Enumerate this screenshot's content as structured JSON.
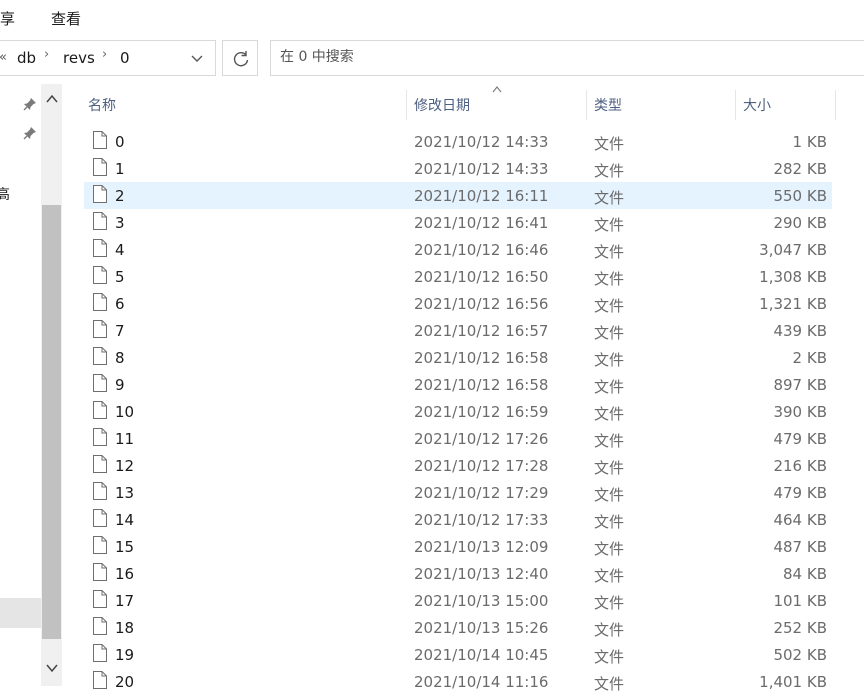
{
  "ribbon": {
    "tabs": [
      "享",
      "查看"
    ]
  },
  "address": {
    "overflow": "«",
    "crumbs": [
      "db",
      "revs",
      "0"
    ],
    "separator": "›",
    "dropdown_icon": "chevron-down-icon",
    "refresh_icon": "refresh-icon"
  },
  "search": {
    "placeholder": "在 0 中搜索",
    "value": ""
  },
  "nav": {
    "fragment": "高"
  },
  "columns": {
    "name": "名称",
    "date": "修改日期",
    "type": "类型",
    "size": "大小",
    "sort_indicator": "^"
  },
  "files": [
    {
      "name": "0",
      "date": "2021/10/12 14:33",
      "type": "文件",
      "size": "1 KB"
    },
    {
      "name": "1",
      "date": "2021/10/12 14:33",
      "type": "文件",
      "size": "282 KB"
    },
    {
      "name": "2",
      "date": "2021/10/12 16:11",
      "type": "文件",
      "size": "550 KB",
      "selected": true
    },
    {
      "name": "3",
      "date": "2021/10/12 16:41",
      "type": "文件",
      "size": "290 KB"
    },
    {
      "name": "4",
      "date": "2021/10/12 16:46",
      "type": "文件",
      "size": "3,047 KB"
    },
    {
      "name": "5",
      "date": "2021/10/12 16:50",
      "type": "文件",
      "size": "1,308 KB"
    },
    {
      "name": "6",
      "date": "2021/10/12 16:56",
      "type": "文件",
      "size": "1,321 KB"
    },
    {
      "name": "7",
      "date": "2021/10/12 16:57",
      "type": "文件",
      "size": "439 KB"
    },
    {
      "name": "8",
      "date": "2021/10/12 16:58",
      "type": "文件",
      "size": "2 KB"
    },
    {
      "name": "9",
      "date": "2021/10/12 16:58",
      "type": "文件",
      "size": "897 KB"
    },
    {
      "name": "10",
      "date": "2021/10/12 16:59",
      "type": "文件",
      "size": "390 KB"
    },
    {
      "name": "11",
      "date": "2021/10/12 17:26",
      "type": "文件",
      "size": "479 KB"
    },
    {
      "name": "12",
      "date": "2021/10/12 17:28",
      "type": "文件",
      "size": "216 KB"
    },
    {
      "name": "13",
      "date": "2021/10/12 17:29",
      "type": "文件",
      "size": "479 KB"
    },
    {
      "name": "14",
      "date": "2021/10/12 17:33",
      "type": "文件",
      "size": "464 KB"
    },
    {
      "name": "15",
      "date": "2021/10/13 12:09",
      "type": "文件",
      "size": "487 KB"
    },
    {
      "name": "16",
      "date": "2021/10/13 12:40",
      "type": "文件",
      "size": "84 KB"
    },
    {
      "name": "17",
      "date": "2021/10/13 15:00",
      "type": "文件",
      "size": "101 KB"
    },
    {
      "name": "18",
      "date": "2021/10/13 15:26",
      "type": "文件",
      "size": "252 KB"
    },
    {
      "name": "19",
      "date": "2021/10/14 10:45",
      "type": "文件",
      "size": "502 KB"
    },
    {
      "name": "20",
      "date": "2021/10/14 11:16",
      "type": "文件",
      "size": "1,401 KB"
    }
  ],
  "colors": {
    "selected_row": "#e5f3ff",
    "header_text": "#4d6082",
    "secondary_text": "#6b6b6b"
  }
}
